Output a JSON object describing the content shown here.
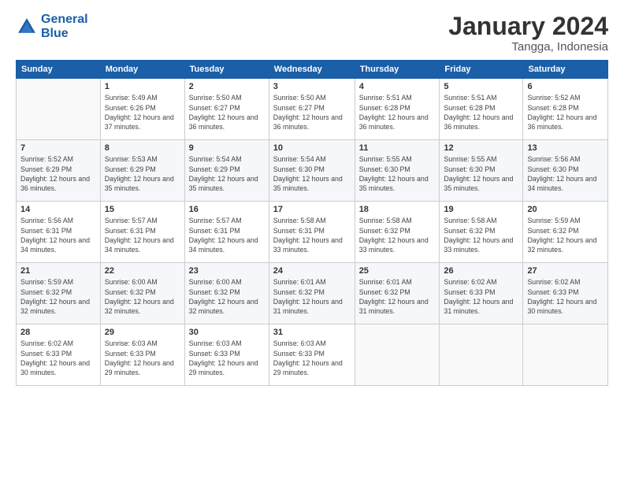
{
  "logo": {
    "line1": "General",
    "line2": "Blue"
  },
  "title": "January 2024",
  "subtitle": "Tangga, Indonesia",
  "header_days": [
    "Sunday",
    "Monday",
    "Tuesday",
    "Wednesday",
    "Thursday",
    "Friday",
    "Saturday"
  ],
  "weeks": [
    [
      {
        "day": "",
        "info": ""
      },
      {
        "day": "1",
        "info": "Sunrise: 5:49 AM\nSunset: 6:26 PM\nDaylight: 12 hours\nand 37 minutes."
      },
      {
        "day": "2",
        "info": "Sunrise: 5:50 AM\nSunset: 6:27 PM\nDaylight: 12 hours\nand 36 minutes."
      },
      {
        "day": "3",
        "info": "Sunrise: 5:50 AM\nSunset: 6:27 PM\nDaylight: 12 hours\nand 36 minutes."
      },
      {
        "day": "4",
        "info": "Sunrise: 5:51 AM\nSunset: 6:28 PM\nDaylight: 12 hours\nand 36 minutes."
      },
      {
        "day": "5",
        "info": "Sunrise: 5:51 AM\nSunset: 6:28 PM\nDaylight: 12 hours\nand 36 minutes."
      },
      {
        "day": "6",
        "info": "Sunrise: 5:52 AM\nSunset: 6:28 PM\nDaylight: 12 hours\nand 36 minutes."
      }
    ],
    [
      {
        "day": "7",
        "info": "Sunrise: 5:52 AM\nSunset: 6:29 PM\nDaylight: 12 hours\nand 36 minutes."
      },
      {
        "day": "8",
        "info": "Sunrise: 5:53 AM\nSunset: 6:29 PM\nDaylight: 12 hours\nand 35 minutes."
      },
      {
        "day": "9",
        "info": "Sunrise: 5:54 AM\nSunset: 6:29 PM\nDaylight: 12 hours\nand 35 minutes."
      },
      {
        "day": "10",
        "info": "Sunrise: 5:54 AM\nSunset: 6:30 PM\nDaylight: 12 hours\nand 35 minutes."
      },
      {
        "day": "11",
        "info": "Sunrise: 5:55 AM\nSunset: 6:30 PM\nDaylight: 12 hours\nand 35 minutes."
      },
      {
        "day": "12",
        "info": "Sunrise: 5:55 AM\nSunset: 6:30 PM\nDaylight: 12 hours\nand 35 minutes."
      },
      {
        "day": "13",
        "info": "Sunrise: 5:56 AM\nSunset: 6:30 PM\nDaylight: 12 hours\nand 34 minutes."
      }
    ],
    [
      {
        "day": "14",
        "info": "Sunrise: 5:56 AM\nSunset: 6:31 PM\nDaylight: 12 hours\nand 34 minutes."
      },
      {
        "day": "15",
        "info": "Sunrise: 5:57 AM\nSunset: 6:31 PM\nDaylight: 12 hours\nand 34 minutes."
      },
      {
        "day": "16",
        "info": "Sunrise: 5:57 AM\nSunset: 6:31 PM\nDaylight: 12 hours\nand 34 minutes."
      },
      {
        "day": "17",
        "info": "Sunrise: 5:58 AM\nSunset: 6:31 PM\nDaylight: 12 hours\nand 33 minutes."
      },
      {
        "day": "18",
        "info": "Sunrise: 5:58 AM\nSunset: 6:32 PM\nDaylight: 12 hours\nand 33 minutes."
      },
      {
        "day": "19",
        "info": "Sunrise: 5:58 AM\nSunset: 6:32 PM\nDaylight: 12 hours\nand 33 minutes."
      },
      {
        "day": "20",
        "info": "Sunrise: 5:59 AM\nSunset: 6:32 PM\nDaylight: 12 hours\nand 32 minutes."
      }
    ],
    [
      {
        "day": "21",
        "info": "Sunrise: 5:59 AM\nSunset: 6:32 PM\nDaylight: 12 hours\nand 32 minutes."
      },
      {
        "day": "22",
        "info": "Sunrise: 6:00 AM\nSunset: 6:32 PM\nDaylight: 12 hours\nand 32 minutes."
      },
      {
        "day": "23",
        "info": "Sunrise: 6:00 AM\nSunset: 6:32 PM\nDaylight: 12 hours\nand 32 minutes."
      },
      {
        "day": "24",
        "info": "Sunrise: 6:01 AM\nSunset: 6:32 PM\nDaylight: 12 hours\nand 31 minutes."
      },
      {
        "day": "25",
        "info": "Sunrise: 6:01 AM\nSunset: 6:32 PM\nDaylight: 12 hours\nand 31 minutes."
      },
      {
        "day": "26",
        "info": "Sunrise: 6:02 AM\nSunset: 6:33 PM\nDaylight: 12 hours\nand 31 minutes."
      },
      {
        "day": "27",
        "info": "Sunrise: 6:02 AM\nSunset: 6:33 PM\nDaylight: 12 hours\nand 30 minutes."
      }
    ],
    [
      {
        "day": "28",
        "info": "Sunrise: 6:02 AM\nSunset: 6:33 PM\nDaylight: 12 hours\nand 30 minutes."
      },
      {
        "day": "29",
        "info": "Sunrise: 6:03 AM\nSunset: 6:33 PM\nDaylight: 12 hours\nand 29 minutes."
      },
      {
        "day": "30",
        "info": "Sunrise: 6:03 AM\nSunset: 6:33 PM\nDaylight: 12 hours\nand 29 minutes."
      },
      {
        "day": "31",
        "info": "Sunrise: 6:03 AM\nSunset: 6:33 PM\nDaylight: 12 hours\nand 29 minutes."
      },
      {
        "day": "",
        "info": ""
      },
      {
        "day": "",
        "info": ""
      },
      {
        "day": "",
        "info": ""
      }
    ]
  ]
}
